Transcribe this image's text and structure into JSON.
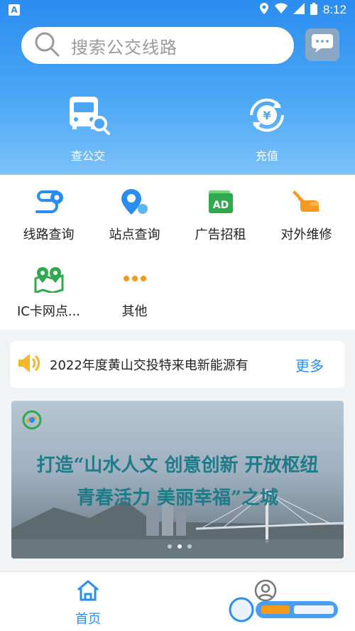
{
  "status_bar": {
    "time": "8:12",
    "app_badge": "A"
  },
  "search": {
    "placeholder": "搜索公交线路"
  },
  "quick_actions": [
    {
      "label": "查公交",
      "icon": "bus-search-icon"
    },
    {
      "label": "充值",
      "icon": "yuan-recharge-icon"
    }
  ],
  "grid": [
    {
      "label": "线路查询",
      "icon": "route-icon"
    },
    {
      "label": "站点查询",
      "icon": "station-icon"
    },
    {
      "label": "广告招租",
      "icon": "ad-icon"
    },
    {
      "label": "对外维修",
      "icon": "repair-icon"
    },
    {
      "label": "IC卡网点...",
      "icon": "map-pin-icon"
    },
    {
      "label": "其他",
      "icon": "more-dots-icon"
    }
  ],
  "notice": {
    "text": "2022年度黄山交投特来电新能源有",
    "more": "更多"
  },
  "banner": {
    "line1": "打造“山水人文 创意创新 开放枢纽",
    "line2": "青春活力 美丽幸福”之城",
    "slides": 3,
    "active_slide": 1
  },
  "bottom_nav": [
    {
      "label": "首页",
      "icon": "home-icon",
      "active": true
    },
    {
      "label": "",
      "icon": "profile-icon",
      "active": false
    }
  ],
  "colors": {
    "primary": "#2a8df0",
    "header_light": "#7cc2f9"
  }
}
